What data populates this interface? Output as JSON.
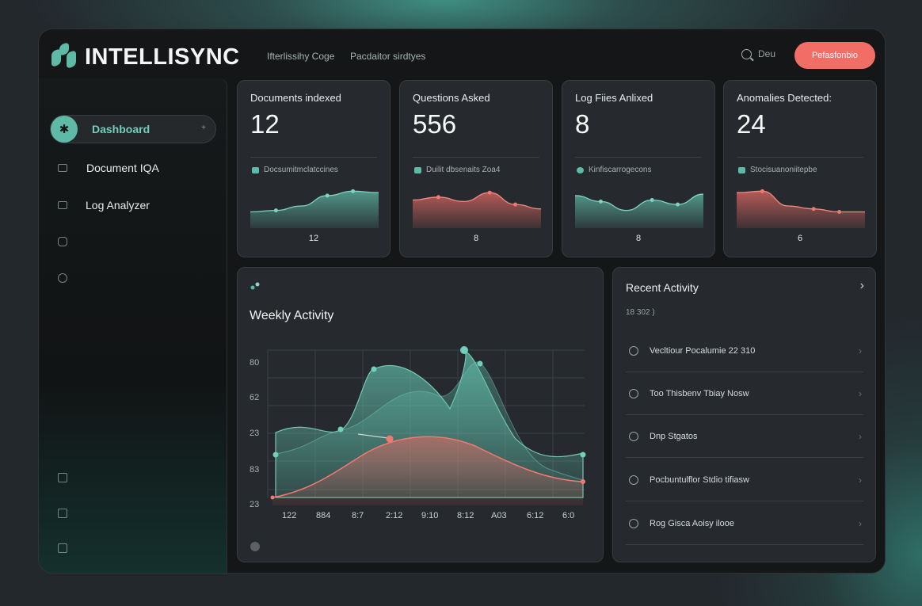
{
  "header": {
    "brand": "INTELLISYNC",
    "nav": [
      "Ifterlissihy Coge",
      "Pacdaitor sirdtyes"
    ],
    "search_label": "Deu",
    "cta_label": "Pefasfonbio"
  },
  "sidebar": {
    "items": [
      {
        "label": "Dashboard",
        "icon": "sparkle-icon",
        "active": true
      },
      {
        "label": "Document IQA",
        "icon": "document-icon"
      },
      {
        "label": "Log Analyzer",
        "icon": "log-icon"
      }
    ]
  },
  "stats": [
    {
      "label": "Documents indexed",
      "value": "12",
      "sub": "Docsumitmclatccines",
      "foot": "12",
      "color": "#5fb9a7",
      "series": [
        22,
        24,
        30,
        44,
        50,
        48
      ]
    },
    {
      "label": "Questions Asked",
      "value": "556",
      "sub": "Duilit dbsenaits Zoa4",
      "foot": "8",
      "color": "#e46a64",
      "series": [
        38,
        42,
        36,
        48,
        32,
        26
      ]
    },
    {
      "label": "Log Fiies Anlixed",
      "value": "8",
      "sub": "Kinfiscarrogecons",
      "foot": "8",
      "color": "#5fb9a7",
      "series": [
        44,
        36,
        24,
        38,
        32,
        46
      ]
    },
    {
      "label": "Anomalies Detected:",
      "value": "24",
      "sub": "Stocisuanoniitepbe",
      "foot": "6",
      "color": "#e46a64",
      "series": [
        48,
        50,
        30,
        26,
        22,
        22
      ]
    }
  ],
  "weekly": {
    "title": "Weekly Activity",
    "y_ticks": [
      "80",
      "62",
      "23",
      "83",
      "23"
    ],
    "x_ticks": [
      "122",
      "884",
      "8:7",
      "2:12",
      "9:10",
      "8:12",
      "A03",
      "6:12",
      "6:0"
    ]
  },
  "recent": {
    "title": "Recent Activity",
    "date": "18 302 )",
    "items": [
      "Vecltiour Pocalumie 22 310",
      "Too Thisbenv Tbiay Nosw",
      "Dnp Stgatos",
      "Pocbuntulflor Stdio tifiasw",
      "Rog Gisca Aoisy ilooe"
    ]
  },
  "colors": {
    "accent": "#5fb9a7",
    "alert": "#e46a64",
    "cta": "#f36d67"
  }
}
